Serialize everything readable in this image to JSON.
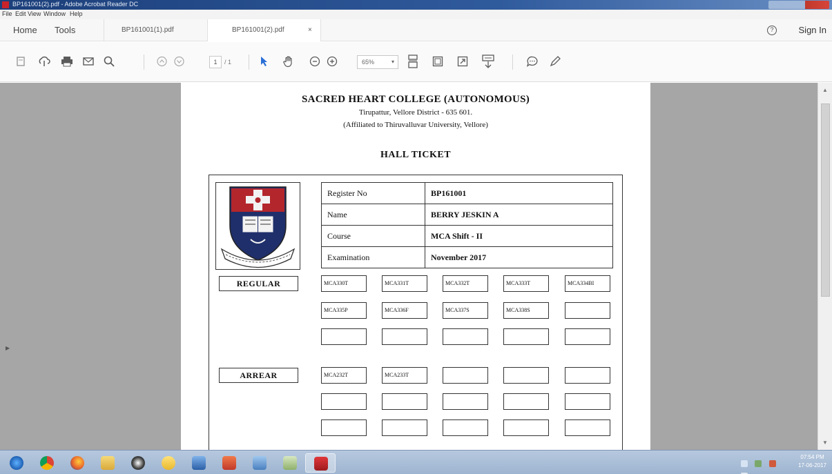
{
  "window": {
    "title": "BP161001(2).pdf - Adobe Acrobat Reader DC"
  },
  "menu": {
    "items": [
      "File",
      "Edit",
      "View",
      "Window",
      "Help"
    ]
  },
  "tabs": {
    "home": "Home",
    "tools": "Tools",
    "file1": "BP161001(1).pdf",
    "file2": "BP161001(2).pdf",
    "close": "×",
    "help": "?",
    "signin": "Sign In"
  },
  "toolbar": {
    "page_current": "1",
    "page_total": "/ 1",
    "zoom": "65%",
    "zoom_caret": "▾"
  },
  "document": {
    "college_name": "SACRED HEART COLLEGE (AUTONOMOUS)",
    "address": "Tirupattur, Vellore District - 635 601.",
    "affiliation": "(Affiliated to Thiruvalluvar University, Vellore)",
    "heading": "HALL TICKET",
    "info": [
      {
        "label": "Register No",
        "value": "BP161001"
      },
      {
        "label": "Name",
        "value": "BERRY JESKIN  A"
      },
      {
        "label": "Course",
        "value": "MCA Shift - II"
      },
      {
        "label": "Examination",
        "value": "November 2017"
      }
    ],
    "regular_label": "REGULAR",
    "arrear_label": "ARREAR",
    "regular_codes": [
      [
        "MCA330T",
        "MCA331T",
        "MCA332T",
        "MCA333T",
        "MCA334BI"
      ],
      [
        "MCA335P",
        "MCA336F",
        "MCA337S",
        "MCA338S",
        ""
      ],
      [
        "",
        "",
        "",
        "",
        ""
      ]
    ],
    "arrear_codes": [
      [
        "MCA232T",
        "MCA233T",
        "",
        "",
        ""
      ],
      [
        "",
        "",
        "",
        "",
        ""
      ],
      [
        "",
        "",
        "",
        "",
        ""
      ]
    ]
  },
  "taskbar": {
    "clock_time": "07:54 PM",
    "clock_date": "17-06-2017"
  },
  "colors": {
    "titlebar": "#1c3f7a",
    "viewer_bg": "#a6a6a6",
    "taskbar": "#b6c8de",
    "logo_red": "#b3262c",
    "logo_navy": "#1f2f6b"
  }
}
